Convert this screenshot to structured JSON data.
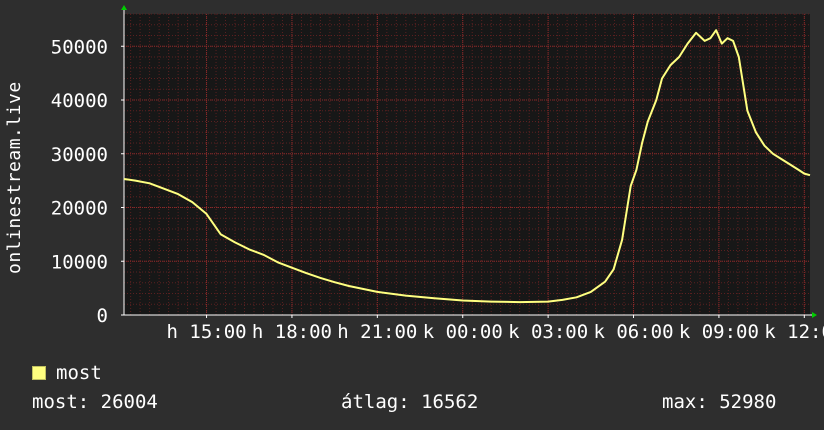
{
  "chart_data": {
    "type": "line",
    "ylabel": "onlinestream.live",
    "ylim": [
      0,
      56000
    ],
    "y_ticks": [
      0,
      10000,
      20000,
      30000,
      40000,
      50000
    ],
    "y_tick_labels": [
      "0",
      "10000",
      "20000",
      "30000",
      "40000",
      "50000"
    ],
    "x_tick_labels": [
      "h 15:00",
      "h 18:00",
      "h 21:00",
      "k 00:00",
      "k 03:00",
      "k 06:00",
      "k 09:00",
      "k 12:00"
    ],
    "x_ticks_hours": [
      15,
      18,
      21,
      24,
      27,
      30,
      33,
      36
    ],
    "xlim_hours": [
      12.1,
      36.2
    ],
    "grid": true,
    "series": [
      {
        "name": "most",
        "color": "#ffff80",
        "x_hours": [
          12.1,
          12.5,
          13.0,
          13.5,
          14.0,
          14.5,
          15.0,
          15.5,
          16.0,
          16.5,
          17.0,
          17.5,
          18.0,
          18.5,
          19.0,
          19.5,
          20.0,
          21.0,
          22.0,
          23.0,
          24.0,
          25.0,
          26.0,
          27.0,
          27.5,
          28.0,
          28.5,
          29.0,
          29.3,
          29.6,
          29.9,
          30.1,
          30.3,
          30.5,
          30.8,
          31.0,
          31.3,
          31.6,
          31.9,
          32.2,
          32.5,
          32.7,
          32.9,
          33.1,
          33.3,
          33.5,
          33.7,
          34.0,
          34.3,
          34.6,
          34.9,
          35.2,
          35.5,
          35.8,
          36.0,
          36.2
        ],
        "values": [
          25300,
          25000,
          24500,
          23500,
          22500,
          21000,
          18800,
          15000,
          13500,
          12200,
          11200,
          9800,
          8800,
          7800,
          6900,
          6100,
          5400,
          4300,
          3600,
          3100,
          2700,
          2500,
          2400,
          2500,
          2800,
          3300,
          4300,
          6200,
          8500,
          14000,
          24000,
          27000,
          32000,
          36000,
          40000,
          44000,
          46500,
          48000,
          50500,
          52500,
          51000,
          51500,
          52980,
          50500,
          51500,
          51000,
          48000,
          38000,
          34000,
          31500,
          30000,
          29000,
          28000,
          27000,
          26300,
          26004
        ]
      }
    ]
  },
  "legend": {
    "label": "most"
  },
  "stats": {
    "current": "most: 26004",
    "average": "átlag: 16562",
    "max": "max: 52980"
  }
}
